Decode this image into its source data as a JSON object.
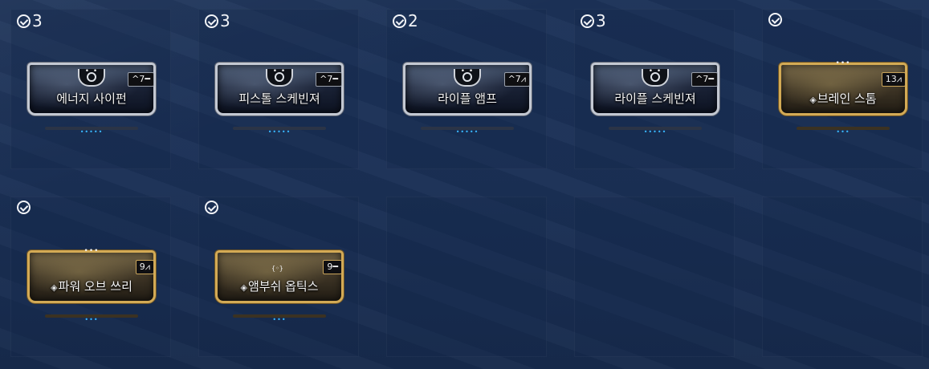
{
  "mods": [
    {
      "name": "에너지 사이펀",
      "owned": "3",
      "rank": "^7━",
      "style": "silver",
      "rare_marker": "",
      "pips": "•••••",
      "polarity": "circle"
    },
    {
      "name": "피스톨 스케빈져",
      "owned": "3",
      "rank": "^7━",
      "style": "silver",
      "rare_marker": "",
      "pips": "•••••",
      "polarity": "circle"
    },
    {
      "name": "라이플 앰프",
      "owned": "2",
      "rank": "^7⩘",
      "style": "silver",
      "rare_marker": "",
      "pips": "•••••",
      "polarity": "circle"
    },
    {
      "name": "라이플 스케빈져",
      "owned": "3",
      "rank": "^7━",
      "style": "silver",
      "rare_marker": "",
      "pips": "•••••",
      "polarity": "circle"
    },
    {
      "name": "브레인 스톰",
      "owned": "",
      "rank": "13⩘",
      "style": "gold",
      "rare_marker": "◈",
      "pips": "•••",
      "polarity": "dots"
    },
    {
      "name": "파워 오브 쓰리",
      "owned": "",
      "rank": "9⩘",
      "style": "gold",
      "rare_marker": "◈",
      "pips": "•••",
      "polarity": "dots"
    },
    {
      "name": "앰부쉬 옵틱스",
      "owned": "",
      "rank": "9━",
      "style": "gold",
      "rare_marker": "◈",
      "pips": "•••",
      "polarity": "dots"
    }
  ],
  "pips_color": "#39b7ff",
  "silver_frame_color": "#c3c8d2",
  "gold_frame_color": "#d3aa55"
}
